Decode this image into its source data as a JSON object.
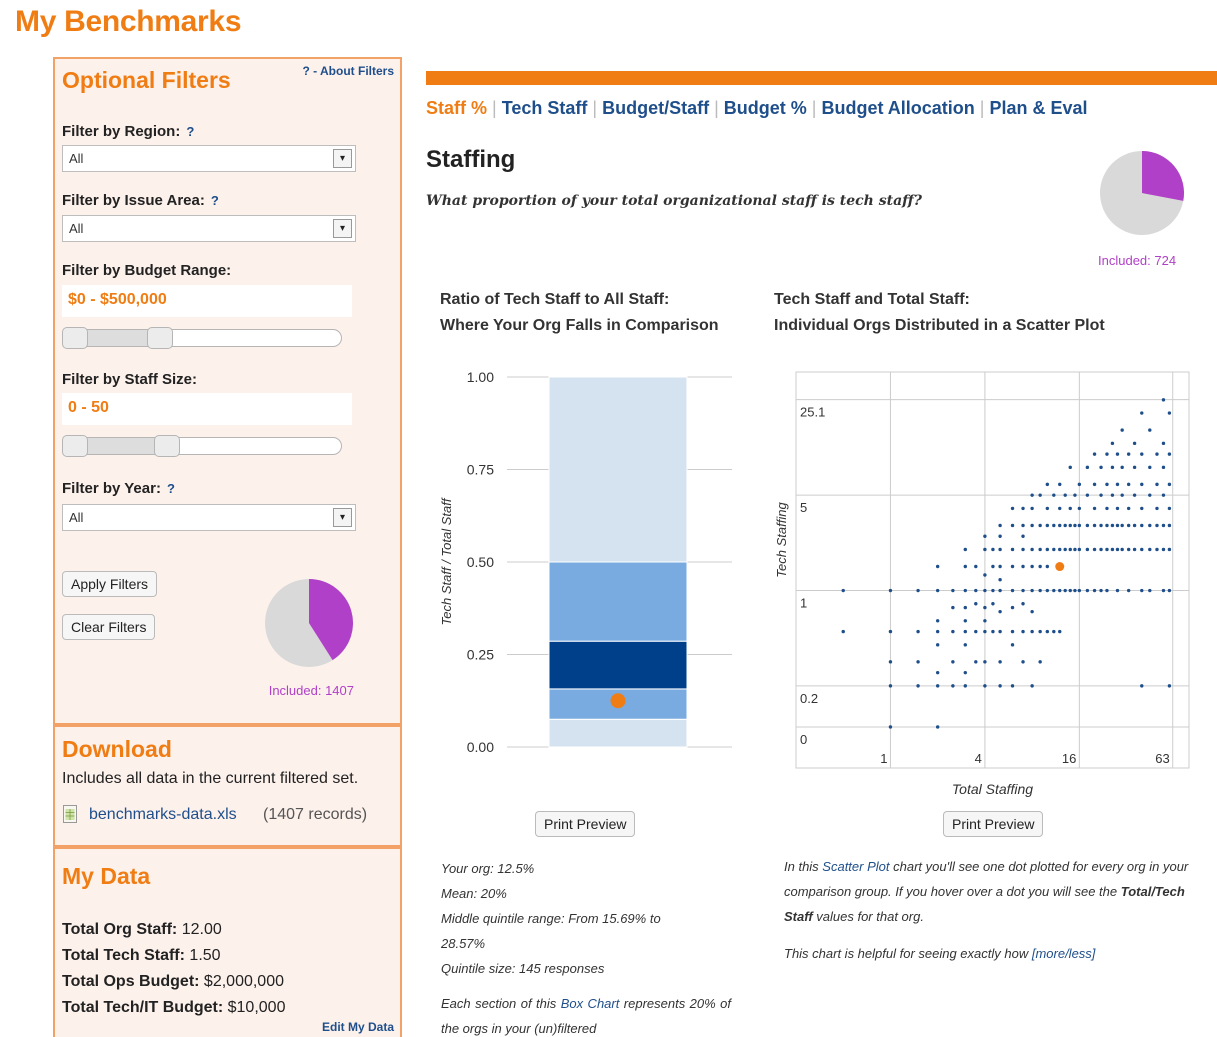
{
  "page": {
    "title": "My Benchmarks"
  },
  "filters": {
    "title": "Optional Filters",
    "about_link": "? - About Filters",
    "region": {
      "label": "Filter by Region:",
      "help": "?",
      "value": "All"
    },
    "issue_area": {
      "label": "Filter by Issue Area:",
      "help": "?",
      "value": "All"
    },
    "budget_range": {
      "label": "Filter by Budget Range:",
      "value": "$0 - $500,000",
      "slider_low": 0.0,
      "slider_high": 0.33
    },
    "staff_size": {
      "label": "Filter by Staff Size:",
      "value": "0 - 50",
      "slider_low": 0.0,
      "slider_high": 0.36
    },
    "year": {
      "label": "Filter by Year:",
      "help": "?",
      "value": "All"
    },
    "apply_label": "Apply Filters",
    "clear_label": "Clear Filters",
    "included_label": "Included: 1407",
    "included_fraction": 0.41
  },
  "download": {
    "title": "Download",
    "description": "Includes all data in the current filtered set.",
    "file_name": "benchmarks-data.xls",
    "file_records": "(1407 records)",
    "file_icon": "spreadsheet-icon"
  },
  "my_data": {
    "title": "My Data",
    "rows": [
      {
        "label": "Total Org Staff:",
        "value": "12.00"
      },
      {
        "label": "Total Tech Staff:",
        "value": "1.50"
      },
      {
        "label": "Total Ops Budget:",
        "value": "$2,000,000"
      },
      {
        "label": "Total Tech/IT Budget:",
        "value": "$10,000"
      }
    ],
    "edit_link": "Edit My Data"
  },
  "tabs": [
    {
      "label": "Staff %",
      "active": true
    },
    {
      "label": "Tech Staff",
      "active": false
    },
    {
      "label": "Budget/Staff",
      "active": false
    },
    {
      "label": "Budget %",
      "active": false
    },
    {
      "label": "Budget Allocation",
      "active": false
    },
    {
      "label": "Plan & Eval",
      "active": false
    }
  ],
  "section": {
    "title": "Staffing",
    "question": "What proportion of your total organizational staff is tech staff?",
    "included_label": "Included: 724",
    "included_fraction": 0.28
  },
  "box_chart": {
    "title_line1": "Ratio of Tech Staff to All Staff:",
    "title_line2": "Where Your Org Falls in Comparison",
    "print_label": "Print Preview",
    "stats": [
      "Your org: 12.5%",
      "Mean: 20%",
      "Middle quintile range: From 15.69% to",
      "28.57%",
      "Quintile size: 145 responses"
    ],
    "desc_prefix": "Each section of this ",
    "desc_link": "Box Chart",
    "desc_suffix": " represents 20% of the orgs in your (un)filtered"
  },
  "scatter_text": {
    "title_line1": "Tech Staff and Total Staff:",
    "title_line2": "Individual Orgs Distributed in a Scatter Plot",
    "print_label": "Print Preview",
    "desc_prefix": "In this ",
    "desc_link": "Scatter Plot",
    "desc_middle": " chart you'll see one dot plotted for every org in your comparison group. If you hover over a dot you will see the ",
    "desc_bold": "Total/Tech Staff",
    "desc_suffix": " values for that org.",
    "helpful": "This chart is helpful for seeing exactly how ",
    "more_less": "[more/less]"
  },
  "chart_data": [
    {
      "type": "box",
      "ylabel": "Tech Staff / Total Staff",
      "ylim": [
        0,
        1
      ],
      "yticks": [
        "0.00",
        "0.25",
        "0.50",
        "0.75",
        "1.00"
      ],
      "yticks_values": [
        0,
        0.25,
        0.5,
        0.75,
        1
      ],
      "quintile_bounds": [
        0.0,
        0.075,
        0.157,
        0.286,
        0.5,
        1.0
      ],
      "quintile_colors": [
        "#d4e3ef",
        "#7aabe0",
        "#003f8a",
        "#7aabe0",
        "#d4e3ef"
      ],
      "your_org": 0.125,
      "marker_color": "#ef7d14"
    },
    {
      "type": "scatter",
      "xlabel": "Total Staffing",
      "ylabel": "Tech Staffing",
      "xticks": [
        "1",
        "4",
        "16",
        "63"
      ],
      "yticks": [
        "0",
        "0.2",
        "1",
        "5",
        "25.1"
      ],
      "your_org": {
        "x": 12,
        "y": 1.5
      },
      "point_color": "#1f4f8b",
      "marker_color": "#ef7d14",
      "points": [
        [
          0.5,
          0.5
        ],
        [
          0.5,
          1
        ],
        [
          1,
          0.1
        ],
        [
          1,
          0.2
        ],
        [
          1,
          0.3
        ],
        [
          1,
          0.5
        ],
        [
          1,
          1
        ],
        [
          1.5,
          0.2
        ],
        [
          1.5,
          0.3
        ],
        [
          1.5,
          0.5
        ],
        [
          1.5,
          1
        ],
        [
          2,
          0.1
        ],
        [
          2,
          0.2
        ],
        [
          2,
          0.25
        ],
        [
          2,
          0.4
        ],
        [
          2,
          0.5
        ],
        [
          2,
          0.6
        ],
        [
          2,
          1
        ],
        [
          2,
          1.5
        ],
        [
          2.5,
          0.2
        ],
        [
          2.5,
          0.3
        ],
        [
          2.5,
          0.5
        ],
        [
          2.5,
          0.75
        ],
        [
          2.5,
          1
        ],
        [
          3,
          0.2
        ],
        [
          3,
          0.25
        ],
        [
          3,
          0.4
        ],
        [
          3,
          0.5
        ],
        [
          3,
          0.6
        ],
        [
          3,
          0.75
        ],
        [
          3,
          1
        ],
        [
          3,
          1.5
        ],
        [
          3,
          2
        ],
        [
          3.5,
          0.3
        ],
        [
          3.5,
          0.5
        ],
        [
          3.5,
          0.8
        ],
        [
          3.5,
          1
        ],
        [
          3.5,
          1.5
        ],
        [
          4,
          0.2
        ],
        [
          4,
          0.3
        ],
        [
          4,
          0.5
        ],
        [
          4,
          0.6
        ],
        [
          4,
          0.75
        ],
        [
          4,
          1
        ],
        [
          4,
          1.3
        ],
        [
          4,
          2
        ],
        [
          4,
          2.5
        ],
        [
          4.5,
          0.5
        ],
        [
          4.5,
          0.8
        ],
        [
          4.5,
          1
        ],
        [
          4.5,
          1.5
        ],
        [
          4.5,
          2
        ],
        [
          5,
          0.2
        ],
        [
          5,
          0.3
        ],
        [
          5,
          0.5
        ],
        [
          5,
          0.7
        ],
        [
          5,
          1
        ],
        [
          5,
          1.2
        ],
        [
          5,
          1.5
        ],
        [
          5,
          2
        ],
        [
          5,
          2.5
        ],
        [
          5,
          3
        ],
        [
          6,
          0.2
        ],
        [
          6,
          0.4
        ],
        [
          6,
          0.5
        ],
        [
          6,
          0.75
        ],
        [
          6,
          1
        ],
        [
          6,
          1.5
        ],
        [
          6,
          2
        ],
        [
          6,
          3
        ],
        [
          6,
          4
        ],
        [
          7,
          0.3
        ],
        [
          7,
          0.5
        ],
        [
          7,
          0.8
        ],
        [
          7,
          1
        ],
        [
          7,
          1.5
        ],
        [
          7,
          2
        ],
        [
          7,
          2.5
        ],
        [
          7,
          3
        ],
        [
          7,
          4
        ],
        [
          8,
          0.2
        ],
        [
          8,
          0.5
        ],
        [
          8,
          0.7
        ],
        [
          8,
          1
        ],
        [
          8,
          1.5
        ],
        [
          8,
          2
        ],
        [
          8,
          3
        ],
        [
          8,
          4
        ],
        [
          8,
          5
        ],
        [
          9,
          0.3
        ],
        [
          9,
          0.5
        ],
        [
          9,
          1
        ],
        [
          9,
          1.5
        ],
        [
          9,
          2
        ],
        [
          9,
          3
        ],
        [
          9,
          5
        ],
        [
          10,
          0.5
        ],
        [
          10,
          1
        ],
        [
          10,
          1.5
        ],
        [
          10,
          2
        ],
        [
          10,
          3
        ],
        [
          10,
          4
        ],
        [
          10,
          6
        ],
        [
          11,
          0.5
        ],
        [
          11,
          1
        ],
        [
          11,
          2
        ],
        [
          11,
          3
        ],
        [
          11,
          5
        ],
        [
          12,
          0.5
        ],
        [
          12,
          1
        ],
        [
          12,
          2
        ],
        [
          12,
          3
        ],
        [
          12,
          4
        ],
        [
          12,
          6
        ],
        [
          13,
          1
        ],
        [
          13,
          2
        ],
        [
          13,
          3
        ],
        [
          13,
          5
        ],
        [
          14,
          1
        ],
        [
          14,
          2
        ],
        [
          14,
          3
        ],
        [
          14,
          4
        ],
        [
          14,
          8
        ],
        [
          15,
          1
        ],
        [
          15,
          2
        ],
        [
          15,
          3
        ],
        [
          15,
          5
        ],
        [
          16,
          1
        ],
        [
          16,
          2
        ],
        [
          16,
          3
        ],
        [
          16,
          4
        ],
        [
          16,
          6
        ],
        [
          18,
          1
        ],
        [
          18,
          2
        ],
        [
          18,
          3
        ],
        [
          18,
          5
        ],
        [
          18,
          8
        ],
        [
          20,
          1
        ],
        [
          20,
          2
        ],
        [
          20,
          3
        ],
        [
          20,
          4
        ],
        [
          20,
          6
        ],
        [
          20,
          10
        ],
        [
          22,
          1
        ],
        [
          22,
          2
        ],
        [
          22,
          3
        ],
        [
          22,
          5
        ],
        [
          22,
          8
        ],
        [
          24,
          1
        ],
        [
          24,
          2
        ],
        [
          24,
          3
        ],
        [
          24,
          4
        ],
        [
          24,
          6
        ],
        [
          24,
          10
        ],
        [
          26,
          2
        ],
        [
          26,
          3
        ],
        [
          26,
          5
        ],
        [
          26,
          8
        ],
        [
          26,
          12
        ],
        [
          28,
          1
        ],
        [
          28,
          2
        ],
        [
          28,
          3
        ],
        [
          28,
          4
        ],
        [
          28,
          6
        ],
        [
          28,
          10
        ],
        [
          30,
          2
        ],
        [
          30,
          3
        ],
        [
          30,
          5
        ],
        [
          30,
          8
        ],
        [
          30,
          15
        ],
        [
          33,
          1
        ],
        [
          33,
          2
        ],
        [
          33,
          3
        ],
        [
          33,
          4
        ],
        [
          33,
          6
        ],
        [
          33,
          10
        ],
        [
          36,
          2
        ],
        [
          36,
          3
        ],
        [
          36,
          5
        ],
        [
          36,
          8
        ],
        [
          36,
          12
        ],
        [
          40,
          0.2
        ],
        [
          40,
          1
        ],
        [
          40,
          2
        ],
        [
          40,
          3
        ],
        [
          40,
          4
        ],
        [
          40,
          6
        ],
        [
          40,
          10
        ],
        [
          40,
          20
        ],
        [
          45,
          1
        ],
        [
          45,
          2
        ],
        [
          45,
          3
        ],
        [
          45,
          5
        ],
        [
          45,
          8
        ],
        [
          45,
          15
        ],
        [
          50,
          2
        ],
        [
          50,
          3
        ],
        [
          50,
          4
        ],
        [
          50,
          6
        ],
        [
          50,
          10
        ],
        [
          55,
          1
        ],
        [
          55,
          2
        ],
        [
          55,
          3
        ],
        [
          55,
          5
        ],
        [
          55,
          8
        ],
        [
          55,
          12
        ],
        [
          55,
          25
        ],
        [
          60,
          0.2
        ],
        [
          60,
          1
        ],
        [
          60,
          2
        ],
        [
          60,
          3
        ],
        [
          60,
          4
        ],
        [
          60,
          6
        ],
        [
          60,
          10
        ],
        [
          60,
          20
        ]
      ]
    }
  ]
}
